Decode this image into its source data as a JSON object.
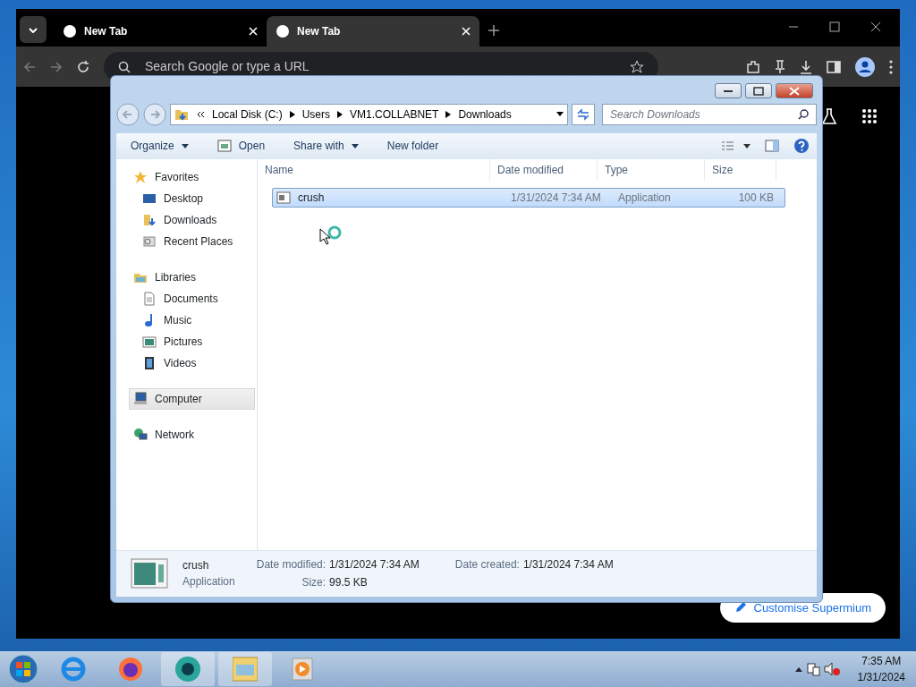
{
  "browser": {
    "tabs": [
      {
        "title": "New Tab",
        "selected": false
      },
      {
        "title": "New Tab",
        "selected": true
      }
    ],
    "omnibox": {
      "placeholder": "Search Google or type a URL"
    },
    "customise_button": "Customise Supermium"
  },
  "explorer": {
    "breadcrumb": [
      "Local Disk (C:)",
      "Users",
      "VM1.COLLABNET",
      "Downloads"
    ],
    "search": {
      "placeholder": "Search Downloads"
    },
    "commands": [
      {
        "label": "Organize",
        "kind": "menu"
      },
      {
        "label": "Open",
        "kind": "open"
      },
      {
        "label": "Share with",
        "kind": "menu"
      },
      {
        "label": "New folder",
        "kind": "plain"
      }
    ],
    "nav": [
      {
        "label": "Favorites",
        "kind": "star",
        "selected": false,
        "children": [
          {
            "label": "Desktop",
            "kind": "desktop",
            "selected": false
          },
          {
            "label": "Downloads",
            "kind": "downloads",
            "selected": false
          },
          {
            "label": "Recent Places",
            "kind": "recent",
            "selected": false
          }
        ]
      },
      {
        "label": "Libraries",
        "kind": "library",
        "selected": false,
        "children": [
          {
            "label": "Documents",
            "kind": "document",
            "selected": false
          },
          {
            "label": "Music",
            "kind": "music",
            "selected": false
          },
          {
            "label": "Pictures",
            "kind": "pictures",
            "selected": false
          },
          {
            "label": "Videos",
            "kind": "videos",
            "selected": false
          }
        ]
      },
      {
        "label": "Computer",
        "kind": "computer",
        "selected": true
      },
      {
        "label": "Network",
        "kind": "network",
        "selected": false
      }
    ],
    "columns": [
      "Name",
      "Date modified",
      "Type",
      "Size"
    ],
    "rows": [
      {
        "name": "crush",
        "date_modified": "1/31/2024 7:34 AM",
        "type": "Application",
        "size": "100 KB",
        "selected": true
      }
    ],
    "details": {
      "name": "crush",
      "type": "Application",
      "fields": [
        {
          "label": "Date modified:",
          "value": "1/31/2024 7:34 AM"
        },
        {
          "label": "Date created:",
          "value": "1/31/2024 7:34 AM"
        },
        {
          "label": "Size:",
          "value": "99.5 KB"
        }
      ]
    }
  },
  "taskbar": {
    "time": "7:35 AM",
    "date": "1/31/2024"
  }
}
